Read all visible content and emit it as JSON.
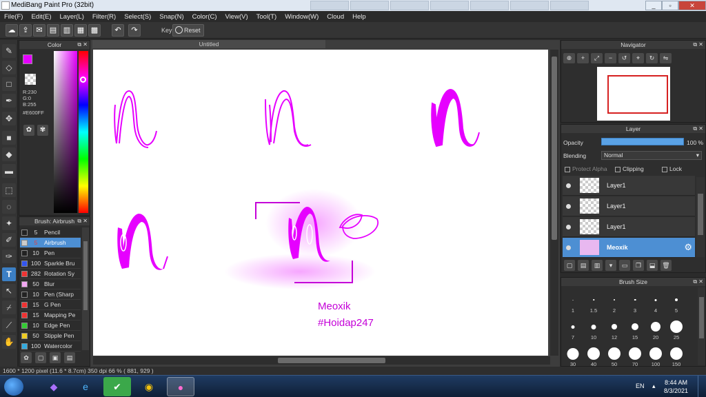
{
  "window": {
    "title": "MediBang Paint Pro (32bit)",
    "min": "_",
    "max": "▫",
    "close": "✕"
  },
  "menu": [
    "File(F)",
    "Edit(E)",
    "Layer(L)",
    "Filter(R)",
    "Select(S)",
    "Snap(N)",
    "Color(C)",
    "View(V)",
    "Tool(T)",
    "Window(W)",
    "Cloud",
    "Help"
  ],
  "toolbar": {
    "key_label": "Key",
    "reset_label": "Reset"
  },
  "color_panel": {
    "title": "Color",
    "r": "R:230",
    "g": "G:0",
    "b": "B:255",
    "hex": "#E600FF",
    "fg_color": "#E600FF",
    "bg_color": "#28C828"
  },
  "brush_panel": {
    "title": "Brush: Airbrush",
    "brushes": [
      {
        "size": "5",
        "name": "Pencil",
        "color": "#222222",
        "selected": false
      },
      {
        "size": "5",
        "name": "Airbrush",
        "color": "#cccccc",
        "selected": true
      },
      {
        "size": "10",
        "name": "Pen",
        "color": "#222222",
        "selected": false
      },
      {
        "size": "100",
        "name": "Sparkle Bru",
        "color": "#3355ee",
        "selected": false
      },
      {
        "size": "282",
        "name": "Rotation Sy",
        "color": "#ee3333",
        "selected": false
      },
      {
        "size": "50",
        "name": "Blur",
        "color": "#f2a8f2",
        "selected": false
      },
      {
        "size": "10",
        "name": "Pen (Sharp",
        "color": "#222222",
        "selected": false
      },
      {
        "size": "15",
        "name": "G Pen",
        "color": "#ee3333",
        "selected": false
      },
      {
        "size": "15",
        "name": "Mapping Pe",
        "color": "#ee3333",
        "selected": false
      },
      {
        "size": "10",
        "name": "Edge Pen",
        "color": "#33cc33",
        "selected": false
      },
      {
        "size": "50",
        "name": "Stipple Pen",
        "color": "#eecc22",
        "selected": false
      },
      {
        "size": "100",
        "name": "Watercolor",
        "color": "#33aadd",
        "selected": false
      }
    ]
  },
  "document": {
    "tab_title": "Untitled",
    "canvas_text_1": "Meoxik",
    "canvas_text_2": "#Hoidap247",
    "ink_color": "#E600FF"
  },
  "status": {
    "text": "1600 * 1200 pixel   (11.6 * 8.7cm)   350 dpi   66 %   ( 881, 929 )"
  },
  "navigator": {
    "title": "Navigator"
  },
  "layer_panel": {
    "title": "Layer",
    "opacity_label": "Opacity",
    "opacity_value": "100 %",
    "blending_label": "Blending",
    "blending_value": "Normal",
    "protect_alpha": "Protect Alpha",
    "clipping": "Clipping",
    "lock": "Lock",
    "layers": [
      {
        "name": "Layer1",
        "selected": false
      },
      {
        "name": "Layer1",
        "selected": false
      },
      {
        "name": "Layer1",
        "selected": false
      },
      {
        "name": "Meoxik",
        "selected": true
      }
    ]
  },
  "brush_size": {
    "title": "Brush Size",
    "sizes": [
      "1",
      "1.5",
      "2",
      "3",
      "4",
      "5",
      "7",
      "10",
      "12",
      "15",
      "20",
      "25",
      "30",
      "40",
      "50",
      "70",
      "100",
      "150"
    ]
  },
  "taskbar": {
    "lang": "EN",
    "time": "8:44 AM",
    "date": "8/3/2021"
  }
}
